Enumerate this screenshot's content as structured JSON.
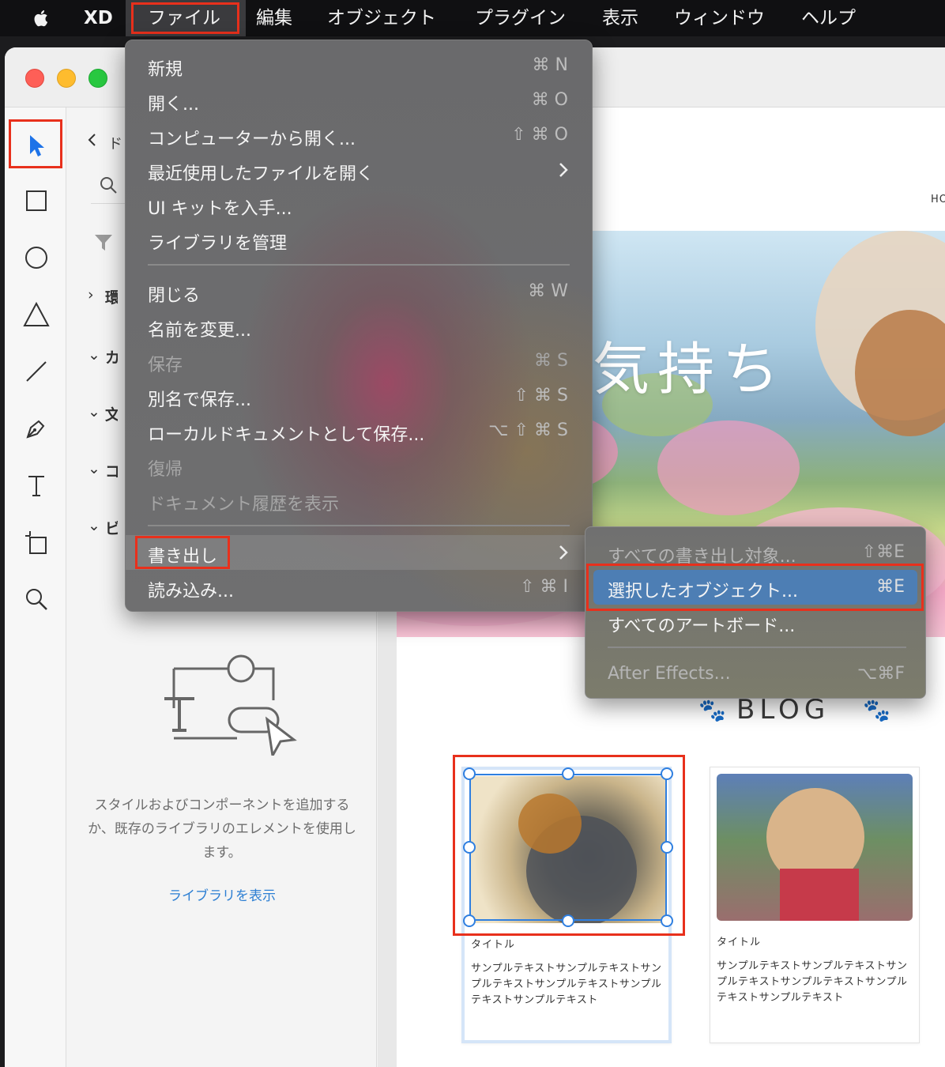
{
  "menubar": {
    "app_name": "XD",
    "items": [
      "ファイル",
      "編集",
      "オブジェクト",
      "プラグイン",
      "表示",
      "ウィンドウ",
      "ヘルプ"
    ]
  },
  "library_panel": {
    "title_fragment": "ド",
    "sections": [
      "環",
      "カ",
      "文",
      "コ",
      "ビ"
    ],
    "empty_description": "スタイルおよびコンポーネントを追加するか、既存のライブラリのエレメントを使用します。",
    "show_library_link": "ライブラリを表示"
  },
  "file_menu": {
    "items": [
      {
        "label": "新規",
        "shortcut": "⌘ N"
      },
      {
        "label": "開く...",
        "shortcut": "⌘ O"
      },
      {
        "label": "コンピューターから開く...",
        "shortcut": "⇧ ⌘ O"
      },
      {
        "label": "最近使用したファイルを開く",
        "shortcut": ""
      },
      {
        "label": "UI キットを入手...",
        "shortcut": ""
      },
      {
        "label": "ライブラリを管理",
        "shortcut": ""
      },
      {
        "label": "閉じる",
        "shortcut": "⌘ W"
      },
      {
        "label": "名前を変更...",
        "shortcut": ""
      },
      {
        "label": "保存",
        "shortcut": "⌘ S"
      },
      {
        "label": "別名で保存...",
        "shortcut": "⇧ ⌘ S"
      },
      {
        "label": "ローカルドキュメントとして保存...",
        "shortcut": "⌥ ⇧ ⌘ S"
      },
      {
        "label": "復帰",
        "shortcut": ""
      },
      {
        "label": "ドキュメント履歴を表示",
        "shortcut": ""
      },
      {
        "label": "書き出し",
        "shortcut": ""
      },
      {
        "label": "読み込み...",
        "shortcut": "⇧ ⌘ I"
      }
    ]
  },
  "export_submenu": {
    "items": [
      {
        "label": "すべての書き出し対象...",
        "shortcut": "⇧⌘E"
      },
      {
        "label": "選択したオブジェクト...",
        "shortcut": "⌘E"
      },
      {
        "label": "すべてのアートボード...",
        "shortcut": ""
      },
      {
        "label": "After Effects...",
        "shortcut": "⌥⌘F"
      }
    ]
  },
  "artboard": {
    "nav_fragment": "HO",
    "hero_text": "気持ち",
    "blog_heading": "BLOG",
    "cards": [
      {
        "title": "タイトル",
        "text": "サンプルテキストサンプルテキストサンプルテキストサンプルテキストサンプルテキストサンプルテキスト"
      },
      {
        "title": "タイトル",
        "text": "サンプルテキストサンプルテキストサンプルテキストサンプルテキストサンプルテキストサンプルテキスト"
      }
    ]
  },
  "colors": {
    "highlight_red": "#e8301c",
    "selection_blue": "#2f7fe0",
    "submenu_selected": "#4d7eb4",
    "link_blue": "#2d7fd3"
  }
}
